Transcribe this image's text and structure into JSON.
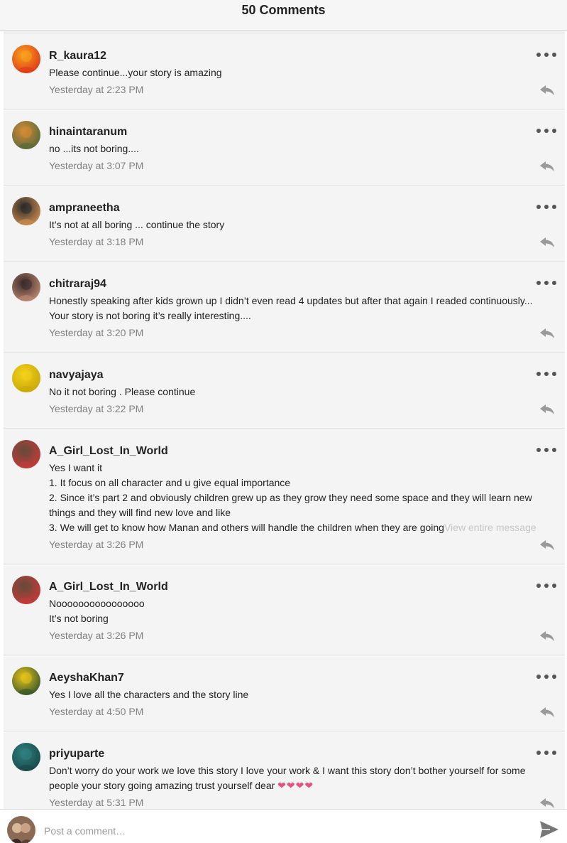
{
  "header": {
    "title": "50 Comments"
  },
  "comments": [
    {
      "username": "R_kaura12",
      "lines": [
        "Please continue...your story is amazing"
      ],
      "timestamp": "Yesterday at 2:23 PM",
      "avatar_icon": "fire-avatar-icon",
      "avatar_colors": [
        "#f7a21b",
        "#e03a1a"
      ]
    },
    {
      "username": "hinaintaranum",
      "lines": [
        "no ...its not boring...."
      ],
      "timestamp": "Yesterday at 3:07 PM",
      "avatar_icon": "autumn-road-avatar-icon",
      "avatar_colors": [
        "#d28a35",
        "#5b6b3a"
      ]
    },
    {
      "username": "ampraneetha",
      "lines": [
        "It’s not at all boring ... continue the story"
      ],
      "timestamp": "Yesterday at 3:18 PM",
      "avatar_icon": "sunset-avatar-icon",
      "avatar_colors": [
        "#2b2b2b",
        "#c88a4e"
      ]
    },
    {
      "username": "chitraraj94",
      "lines": [
        "Honestly speaking after kids grown up I didn’t even read 4 updates but after that again I readed continuously...",
        "Your story is not boring it’s really interesting...."
      ],
      "timestamp": "Yesterday at 3:20 PM",
      "avatar_icon": "couple-avatar-icon",
      "avatar_colors": [
        "#3b2b2b",
        "#b98670"
      ]
    },
    {
      "username": "navyajaya",
      "lines": [
        "No it not boring . Please continue"
      ],
      "timestamp": "Yesterday at 3:22 PM",
      "avatar_icon": "yellow-flowers-avatar-icon",
      "avatar_colors": [
        "#f2d11a",
        "#c9a908"
      ]
    },
    {
      "username": "A_Girl_Lost_In_World",
      "lines": [
        "Yes I want it",
        "1. It focus on all character and u give equal importance",
        "2. Since it’s part 2 and obviously children grew up as they grow they need some space and they will learn new things and they will find new love and like",
        "3. We will get to know how Manan and others will handle the children when they are going"
      ],
      "view_more": "View entire message",
      "timestamp": "Yesterday at 3:26 PM",
      "avatar_icon": "couple-avatar-icon",
      "avatar_colors": [
        "#6b4a3a",
        "#c23a3a"
      ]
    },
    {
      "username": "A_Girl_Lost_In_World",
      "lines": [
        "Noooooooooooooooo",
        "It’s not boring"
      ],
      "timestamp": "Yesterday at 3:26 PM",
      "avatar_icon": "couple-avatar-icon",
      "avatar_colors": [
        "#6b4a3a",
        "#c23a3a"
      ]
    },
    {
      "username": "AeyshaKhan7",
      "lines": [
        "Yes  I  love  all the characters   and the story  line"
      ],
      "timestamp": "Yesterday at 4:50 PM",
      "avatar_icon": "bouquet-avatar-icon",
      "avatar_colors": [
        "#e8c21a",
        "#3b5a2a"
      ]
    },
    {
      "username": "priyuparte",
      "lines": [
        "Don’t worry do your work we love this story I love your work & I want this story don’t bother yourself for some people your story going amazing trust yourself dear"
      ],
      "hearts": "❤❤❤❤",
      "timestamp": "Yesterday at 5:31 PM",
      "avatar_icon": "teal-avatar-icon",
      "avatar_colors": [
        "#2f7f7f",
        "#184a4a"
      ]
    }
  ],
  "composer": {
    "placeholder": "Post a comment…",
    "avatar_icon": "user-avatar-icon",
    "avatar_colors": [
      "#6b5040",
      "#d9b89a"
    ],
    "send_icon": "send-icon"
  },
  "icons": {
    "more": "more-dots-icon",
    "reply": "reply-icon"
  },
  "colors": {
    "header_bg": "#f6f6f6",
    "list_bg": "#f4f4f4",
    "timestamp": "#808080",
    "view_more": "#c7c7c7",
    "hearts": "#e5528a"
  }
}
